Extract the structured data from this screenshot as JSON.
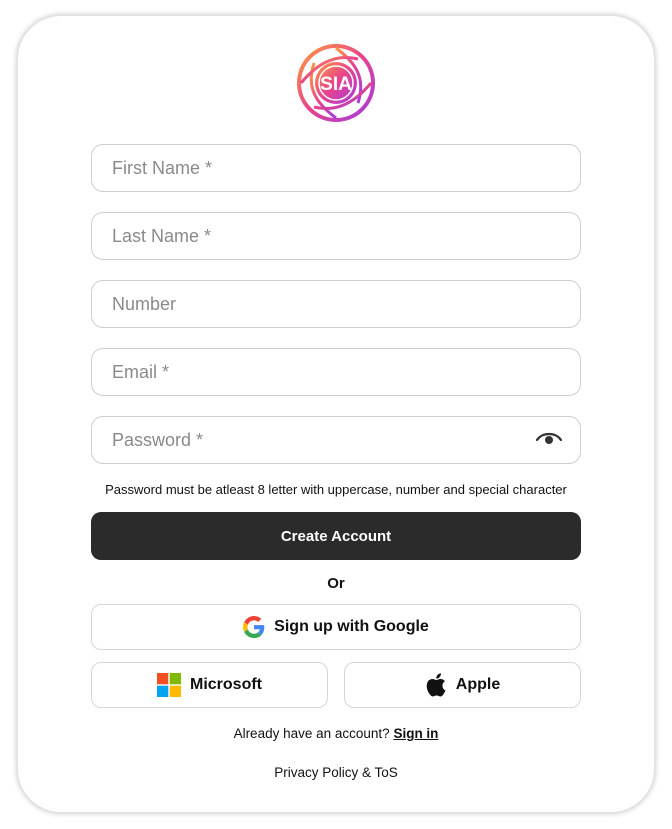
{
  "logo": {
    "text": "SIA"
  },
  "form": {
    "first_name_placeholder": "First Name *",
    "last_name_placeholder": "Last Name *",
    "number_placeholder": "Number",
    "email_placeholder": "Email *",
    "password_placeholder": "Password *",
    "password_hint": "Password must be atleast 8 letter with uppercase, number and special character"
  },
  "actions": {
    "create_account_label": "Create Account",
    "or_label": "Or",
    "google_label": "Sign up with Google",
    "microsoft_label": "Microsoft",
    "apple_label": "Apple"
  },
  "footer": {
    "already_text": "Already have an account?",
    "sign_in_label": "Sign in",
    "legal_label": "Privacy Policy & ToS"
  },
  "icons": {
    "eye": "eye-icon",
    "google": "google-icon",
    "microsoft": "microsoft-icon",
    "apple": "apple-icon"
  },
  "colors": {
    "primary_button": "#2b2b2b",
    "logo_gradient_start": "#ff8a3d",
    "logo_gradient_mid": "#e63f8f",
    "logo_gradient_end": "#a93ce0"
  }
}
